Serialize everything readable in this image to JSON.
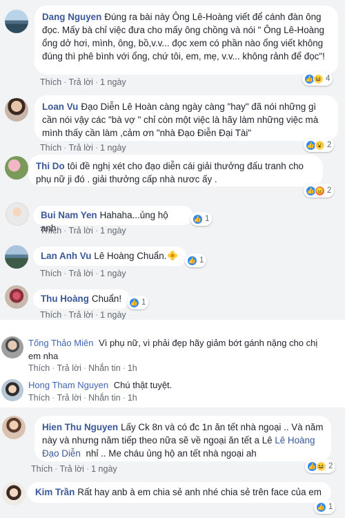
{
  "comments": [
    {
      "name": "Dang Nguyen",
      "text": "Đúng ra bài này Ông Lê-Hoàng viết để cánh đàn ông đọc. Mấy bà chỉ việc đưa cho mấy ông chồng và nói \" Ông Lê-Hoàng ổng dở hơi, mình, ông, bồ,v.v... đọc xem có phần nào ổng viết không đúng thì phê bình với ổng, chứ tôi, em, mẹ, v.v... không rảnh để đọc\"!",
      "like": "Thích",
      "reply": "Trả lời",
      "time": "1 ngày",
      "reactions": "4"
    },
    {
      "name": "Loan Vu",
      "text": "Đạo Diễn Lê Hoàn càng ngày càng \"hay\" đã nói những gì cần nói vậy các \"bà vợ \" chỉ còn một việc là hãy làm những việc mà mình thấy cần làm ,cảm ơn \"nhà Đạo Điễn Đại Tài\"",
      "like": "Thích",
      "reply": "Trả lời",
      "time": "1 ngày",
      "reactions": "2"
    },
    {
      "name": "Thi Do",
      "text": "tôi đề nghị xét cho đạo diễn cái giải thưởng đấu tranh cho phụ nữ ji đó . giải thưởng cấp nhà nươc ấy .",
      "reactions": "2"
    },
    {
      "name": "Bui Nam Yen",
      "text": "Hahaha...ủng hộ anh",
      "like": "Thích",
      "reply": "Trả lời",
      "time": "1 ngày",
      "reactions": "1"
    },
    {
      "name": "Lan Anh Vu",
      "text": "Lê Hoàng Chuẩn.",
      "like": "Thích",
      "reply": "Trả lời",
      "time": "1 ngày",
      "reactions": "1"
    },
    {
      "name": "Thu Hoàng",
      "text": "Chuẩn!",
      "like": "Thích",
      "reply": "Trả lời",
      "time": "1 ngày",
      "reactions": "1"
    }
  ],
  "mobile_comments": [
    {
      "name": "Tống Thảo Miên",
      "text": "Vì phụ nữ, vì phải đẹp hãy giảm bớt gánh nặng cho chị em nha",
      "like": "Thích",
      "reply": "Trả lời",
      "message": "Nhắn tin",
      "time": "1h"
    },
    {
      "name": "Hong Tham Nguyen",
      "text": "Chú thật tuyệt.",
      "like": "Thích",
      "reply": "Trả lời",
      "message": "Nhắn tin",
      "time": "1h"
    }
  ],
  "bottom_comments": [
    {
      "name": "Hien Thu Nguyen",
      "text_before": "Lấy Ck 8n và có đc 1n ăn tết nhà ngoại .. Và năm này và nhưng năm tiếp theo nữa sẽ về ngoại ăn tết a Lê ",
      "mention": "Lê Hoàng Đạo Diễn",
      "text_after": " nhỉ .. Me cháu ủng hộ an tết nhà ngoại ah",
      "like": "Thích",
      "reply": "Trả lời",
      "time": "1 ngày",
      "reactions": "2"
    },
    {
      "name": "Kim Trần",
      "text": "Rất hay anb à em chia sẻ anh nhé chia sẻ trên face của em",
      "reactions": "1"
    }
  ],
  "colors": {
    "name": "#385898",
    "text": "#1d2129",
    "meta": "#606770",
    "like": "#2e89ff"
  }
}
